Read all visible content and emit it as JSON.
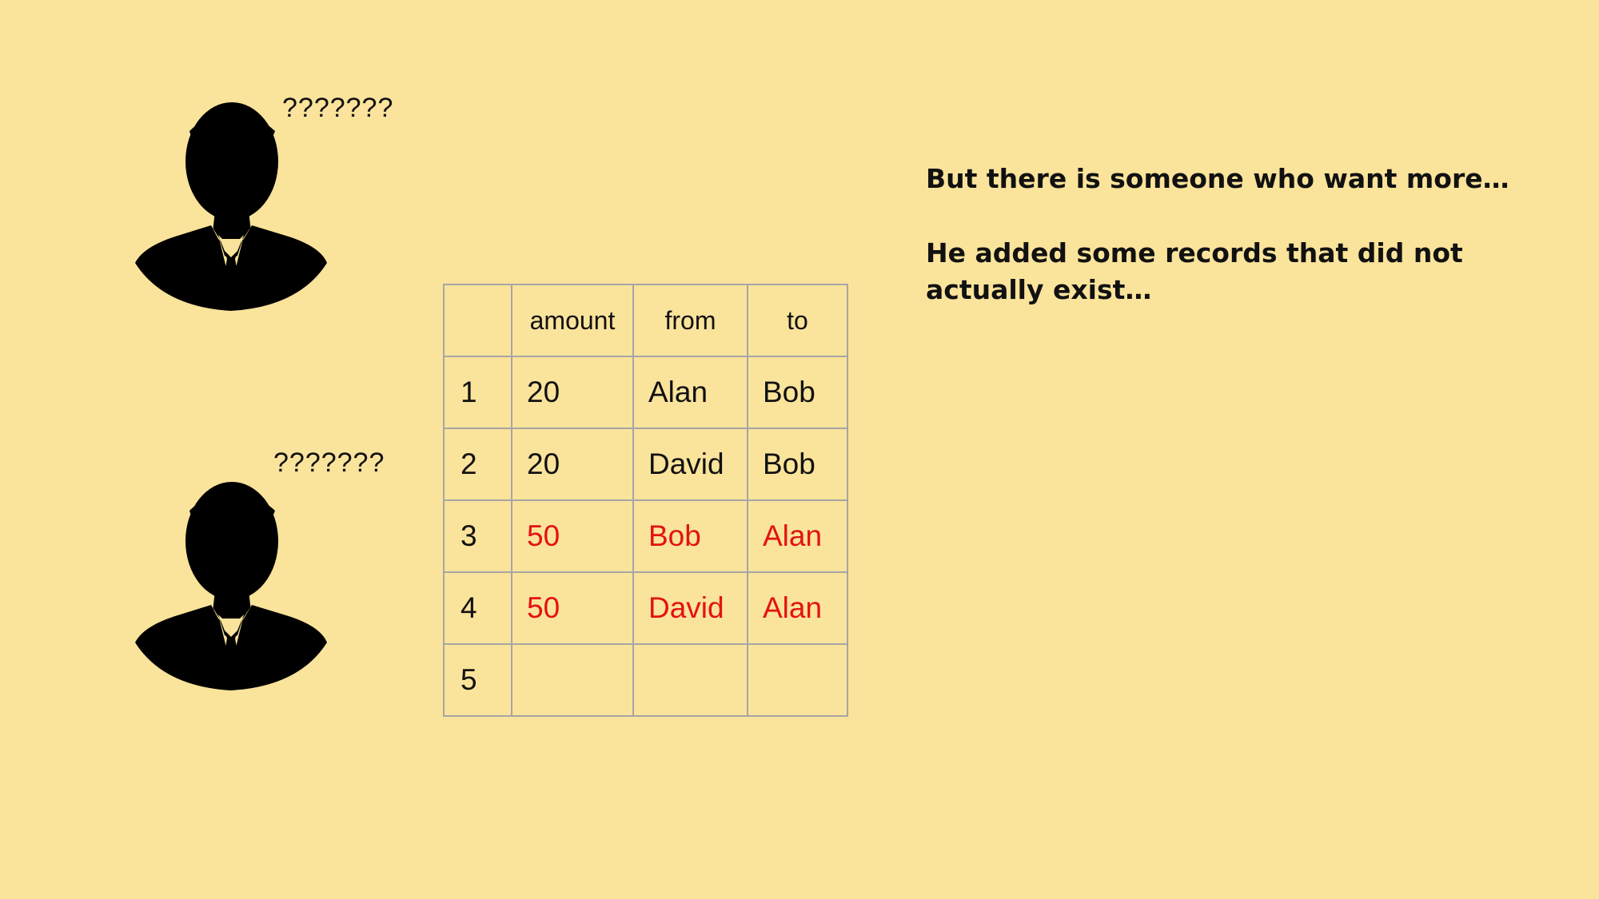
{
  "colors": {
    "background": "#fae39b",
    "silhouette": "#000000",
    "fake_record": "#e31212",
    "grid": "#a6a6a6"
  },
  "people": [
    {
      "icon": "businessman-silhouette-icon",
      "thought": "???????"
    },
    {
      "icon": "businessman-silhouette-icon",
      "thought": "???????"
    }
  ],
  "ledger": {
    "headers": [
      "",
      "amount",
      "from",
      "to"
    ],
    "rows": [
      {
        "index": "1",
        "amount": "20",
        "from": "Alan",
        "to": "Bob",
        "fake": false
      },
      {
        "index": "2",
        "amount": "20",
        "from": "David",
        "to": "Bob",
        "fake": false
      },
      {
        "index": "3",
        "amount": "50",
        "from": "Bob",
        "to": "Alan",
        "fake": true
      },
      {
        "index": "4",
        "amount": "50",
        "from": "David",
        "to": "Alan",
        "fake": true
      },
      {
        "index": "5",
        "amount": "",
        "from": "",
        "to": "",
        "fake": false
      }
    ]
  },
  "captions": [
    "But there is someone who want more…",
    "He added some records that did not\nactually exist…"
  ]
}
